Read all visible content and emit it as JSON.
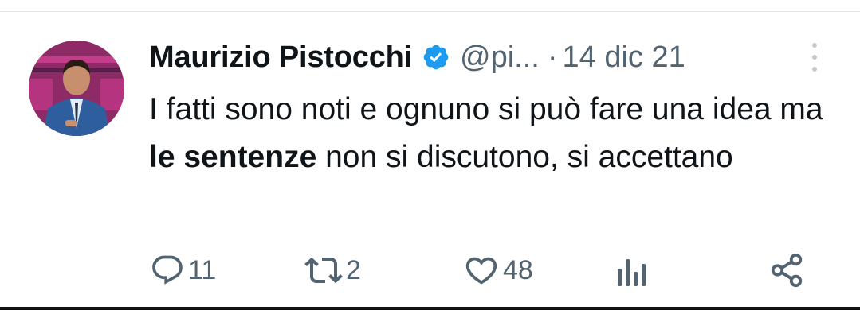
{
  "tweet": {
    "author_name": "Maurizio Pistocchi",
    "handle": "@pi...",
    "separator": "·",
    "date": "14 dic 21",
    "text_part1": "I fatti sono noti e ognuno si può fare una idea ma ",
    "text_bold": "le sentenze",
    "text_part2": " non si discutono, si accettano"
  },
  "actions": {
    "replies": "11",
    "retweets": "2",
    "likes": "48"
  },
  "colors": {
    "text": "#0f1419",
    "secondary": "#536471",
    "verified": "#1d9bf0"
  },
  "icons": [
    "reply-icon",
    "retweet-icon",
    "like-icon",
    "views-icon",
    "share-icon",
    "verified-badge-icon",
    "more-options-icon"
  ]
}
